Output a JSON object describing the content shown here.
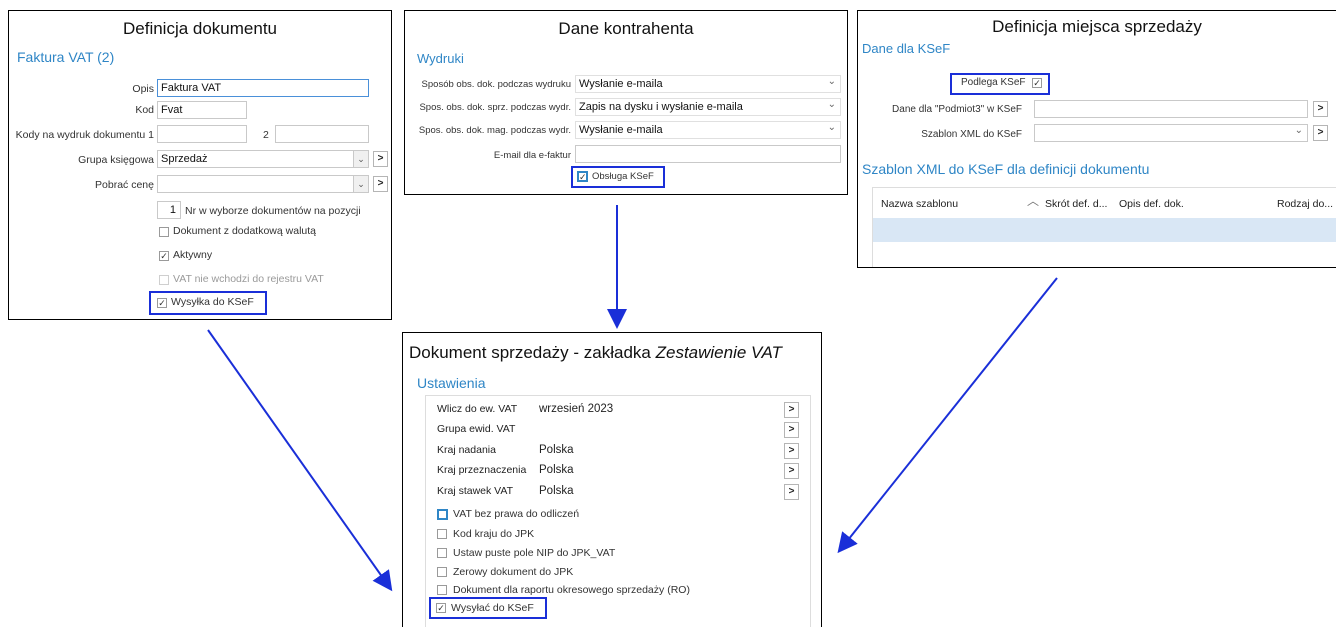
{
  "doc_def": {
    "title": "Definicja dokumentu",
    "subtitle": "Faktura VAT (2)",
    "opis_label": "Opis",
    "opis_value": "Faktura VAT",
    "kod_label": "Kod",
    "kod_value": "Fvat",
    "kody_label": "Kody na wydruk dokumentu 1",
    "kody_num2": "2",
    "grupa_label": "Grupa księgowa",
    "grupa_value": "Sprzedaż",
    "pobrac_label": "Pobrać cenę",
    "pobrac_value": "",
    "nr_value": "1",
    "nr_label": "Nr w wyborze dokumentów na pozycji",
    "waluta_label": "Dokument z dodatkową walutą",
    "aktywny_label": "Aktywny",
    "vat_rejestr_label": "VAT nie wchodzi do rejestru VAT",
    "ksef_label": "Wysyłka do KSeF",
    "checkmark": "✓",
    "arrow_right": ">",
    "chevron_down": "⌄"
  },
  "kontrahent": {
    "title": "Dane kontrahenta",
    "section": "Wydruki",
    "rows": [
      {
        "label": "Sposób obs. dok. podczas wydruku",
        "value": "Wysłanie e-maila"
      },
      {
        "label": "Spos. obs. dok. sprz. podczas wydr.",
        "value": "Zapis na dysku i wysłanie e-maila"
      },
      {
        "label": "Spos. obs. dok. mag. podczas wydr.",
        "value": "Wysłanie e-maila"
      }
    ],
    "email_label": "E-mail dla e-faktur",
    "email_value": "",
    "ksef_label": "Obsługa KSeF"
  },
  "miejsce": {
    "title": "Definicja miejsca sprzedaży",
    "section": "Dane dla KSeF",
    "podlega_label": "Podlega KSeF",
    "podmiot_label": "Dane dla \"Podmiot3\" w KSeF",
    "szablon_label": "Szablon XML do KSeF",
    "grid_section": "Szablon XML do KSeF dla definicji dokumentu",
    "columns": [
      "Nazwa szablonu",
      "Skrót def. d...",
      "Opis def. dok.",
      "Rodzaj do..."
    ]
  },
  "sprzedaz": {
    "title_main": "Dokument sprzedaży - zakładka ",
    "title_italic": "Zestawienie VAT",
    "section": "Ustawienia",
    "rows": [
      {
        "label": "Wlicz do ew. VAT",
        "value": "wrzesień 2023"
      },
      {
        "label": "Grupa ewid. VAT",
        "value": ""
      },
      {
        "label": "Kraj nadania",
        "value": "Polska"
      },
      {
        "label": "Kraj przeznaczenia",
        "value": "Polska"
      },
      {
        "label": "Kraj stawek VAT",
        "value": "Polska"
      }
    ],
    "checkboxes": [
      "VAT bez prawa do odliczeń",
      "Kod kraju do JPK",
      "Ustaw puste pole NIP do JPK_VAT",
      "Zerowy dokument do JPK",
      "Dokument dla raportu okresowego sprzedaży (RO)"
    ],
    "ksef_label": "Wysyłać do KSeF"
  },
  "colors": {
    "highlight": "#1a2fd8",
    "section": "#2f86c6",
    "arrow": "#1a2fd8"
  }
}
